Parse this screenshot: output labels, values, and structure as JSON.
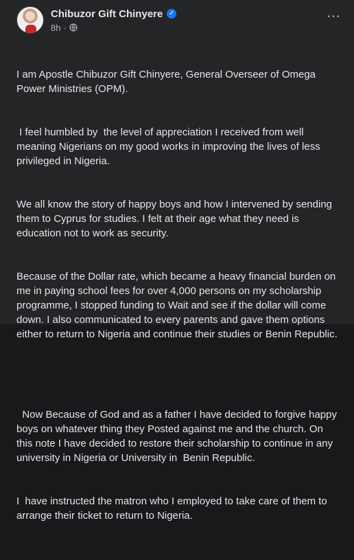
{
  "post": {
    "author": "Chibuzor Gift Chinyere",
    "time": "8h",
    "dot": "·",
    "verified_icon": "verified-badge-icon",
    "privacy_icon": "globe-icon",
    "menu_icon": "more-options-icon",
    "paragraphs": [
      [
        "I am Apostle Chibuzor Gift Chinyere, General Overseer of Omega Power Ministries (OPM).",
        " I feel humbled by  the level of appreciation I received from well meaning Nigerians on my good works in improving the lives of less privileged in Nigeria.",
        "We all know the story of happy boys and how I intervened by sending them to Cyprus for studies. I felt at their age what they need is education not to work as security.",
        "Because of the Dollar rate, which became a heavy financial burden on me in paying school fees for over 4,000 persons on my scholarship programme, I stopped funding to Wait and see if the dollar will come down. I also communicated to every parents and gave them options either to return to Nigeria and continue their studies or Benin Republic."
      ],
      [
        "  Now Because of God and as a father I have decided to forgive happy boys on whatever thing they Posted against me and the church. On this note I have decided to restore their scholarship to continue in any university in Nigeria or University in  Benin Republic.",
        "I  have instructed the matron who I employed to take care of them to arrange their ticket to return to Nigeria."
      ]
    ]
  },
  "colors": {
    "background": "#242526",
    "text": "#e4e6eb",
    "secondary_text": "#b0b3b8",
    "verified": "#1877f2"
  }
}
